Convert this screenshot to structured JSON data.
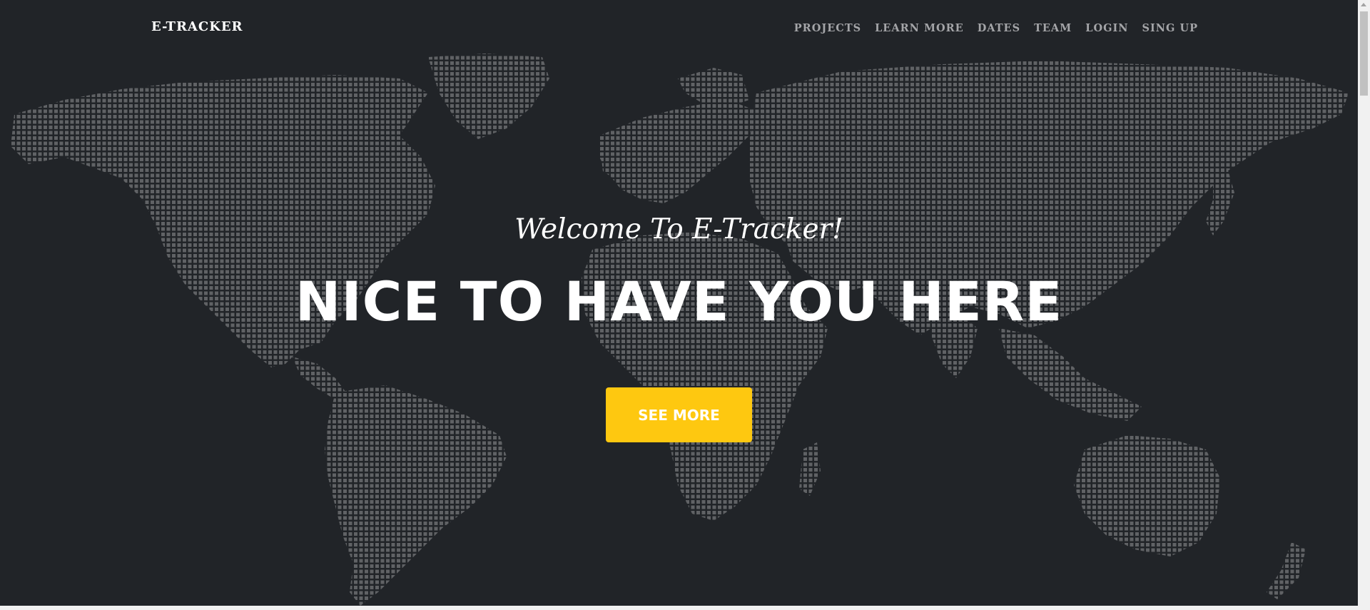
{
  "navbar": {
    "brand": "E-TRACKER",
    "links": [
      {
        "label": "PROJECTS"
      },
      {
        "label": "LEARN MORE"
      },
      {
        "label": "DATES"
      },
      {
        "label": "TEAM"
      },
      {
        "label": "LOGIN"
      },
      {
        "label": "SING UP"
      }
    ]
  },
  "hero": {
    "subheading": "Welcome To E-Tracker!",
    "heading": "NICE TO HAVE YOU HERE",
    "button_label": "SEE MORE"
  },
  "background": {
    "image": "dotted-world-map",
    "dot_color": "#6b6d70"
  },
  "colors": {
    "background": "#212428",
    "accent": "#fec810",
    "nav_text": "#a4a5a8",
    "text": "#ffffff"
  }
}
